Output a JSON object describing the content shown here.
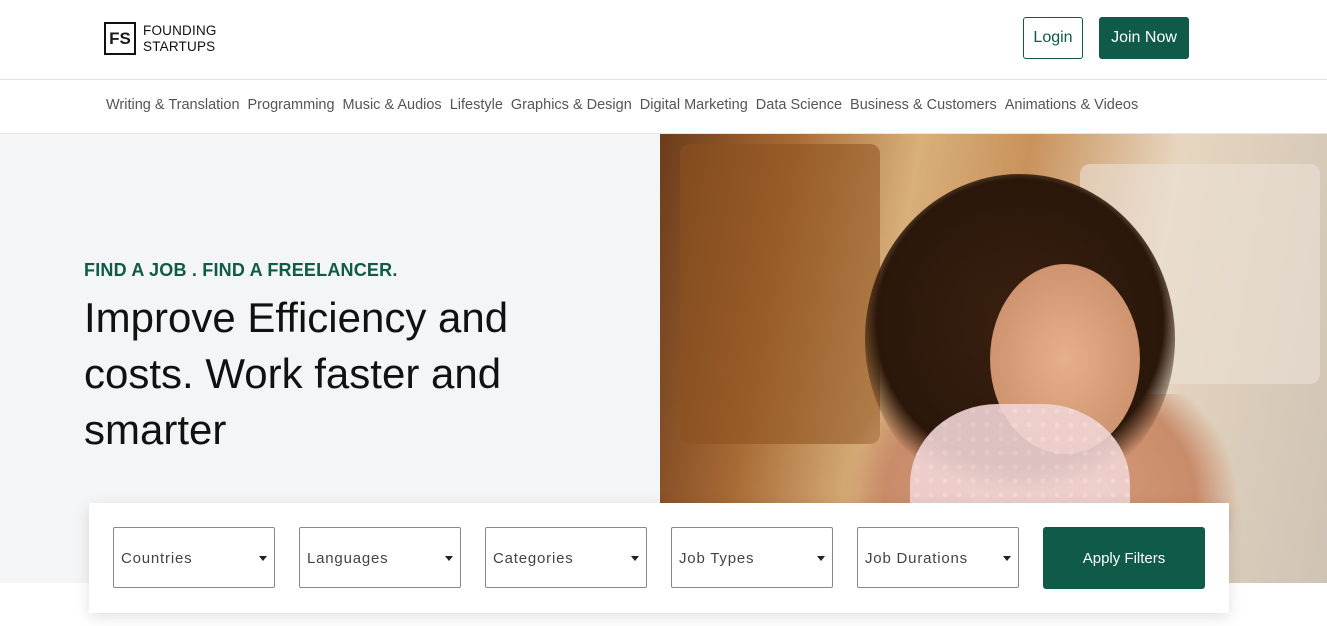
{
  "brand": {
    "logo_mark": "FS",
    "name_line1": "FOUNDING",
    "name_line2": "STARTUPS"
  },
  "header": {
    "login_label": "Login",
    "join_label": "Join Now"
  },
  "categories": [
    "Writing & Translation",
    "Programming",
    "Music & Audios",
    "Lifestyle",
    "Graphics & Design",
    "Digital Marketing",
    "Data Science",
    "Business & Customers",
    "Animations & Videos"
  ],
  "hero": {
    "tagline": "FIND A JOB . FIND A FREELANCER.",
    "headline": "Improve Efficiency and costs. Work faster and smarter"
  },
  "filters": {
    "selects": [
      {
        "label": "Countries"
      },
      {
        "label": "Languages"
      },
      {
        "label": "Categories"
      },
      {
        "label": "Job Types"
      },
      {
        "label": "Job Durations"
      }
    ],
    "apply_label": "Apply Filters"
  },
  "colors": {
    "brand_green": "#0f5a48",
    "hero_bg": "#f4f5f7"
  },
  "icons": {
    "select_caret": "caret-down-icon"
  }
}
